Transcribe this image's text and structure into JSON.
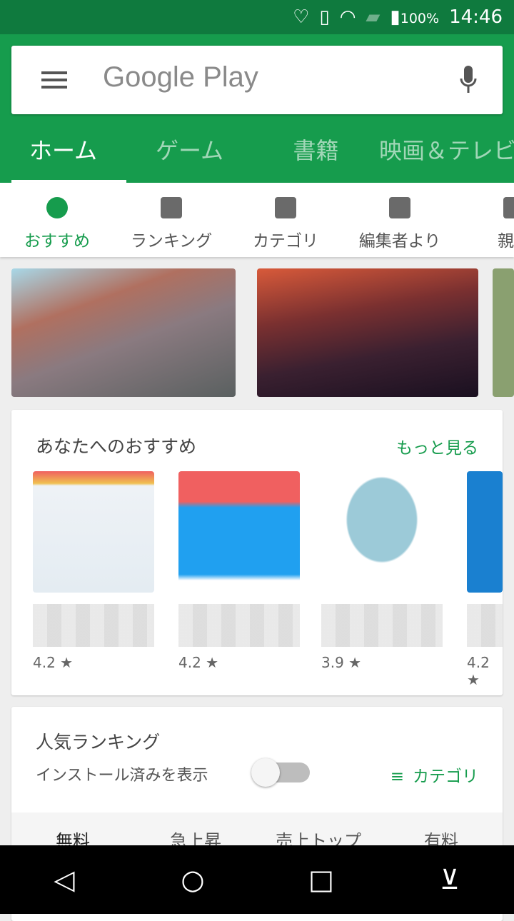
{
  "status": {
    "icons": [
      "heart-mail-icon",
      "screen-rotate-icon",
      "wifi-icon",
      "no-sim-icon",
      "battery-icon"
    ],
    "battery": "100%",
    "time": "14:46"
  },
  "search": {
    "logo": "Google Play"
  },
  "tabs": [
    {
      "label": "ホーム",
      "active": true
    },
    {
      "label": "ゲーム"
    },
    {
      "label": "書籍"
    },
    {
      "label": "映画＆テレビ"
    }
  ],
  "subnav": [
    {
      "label": "おすすめ",
      "icon": "compass-icon",
      "active": true
    },
    {
      "label": "ランキング",
      "icon": "chart-icon"
    },
    {
      "label": "カテゴリ",
      "icon": "shapes-icon"
    },
    {
      "label": "編集者より",
      "icon": "badge-star-icon"
    },
    {
      "label": "親子",
      "icon": "family-icon"
    }
  ],
  "recommend": {
    "title": "あなたへのおすすめ",
    "more": "もっと見る",
    "apps": [
      {
        "rating": "4.2 ★"
      },
      {
        "rating": "4.2 ★"
      },
      {
        "rating": "3.9 ★"
      },
      {
        "rating": "4.2 ★"
      }
    ]
  },
  "ranking": {
    "title": "人気ランキング",
    "toggle_label": "インストール済みを表示",
    "toggle_on": false,
    "category": "カテゴリ",
    "tabs": [
      "無料",
      "急上昇",
      "売上トップ",
      "有料"
    ]
  },
  "accent": "#169c4d"
}
